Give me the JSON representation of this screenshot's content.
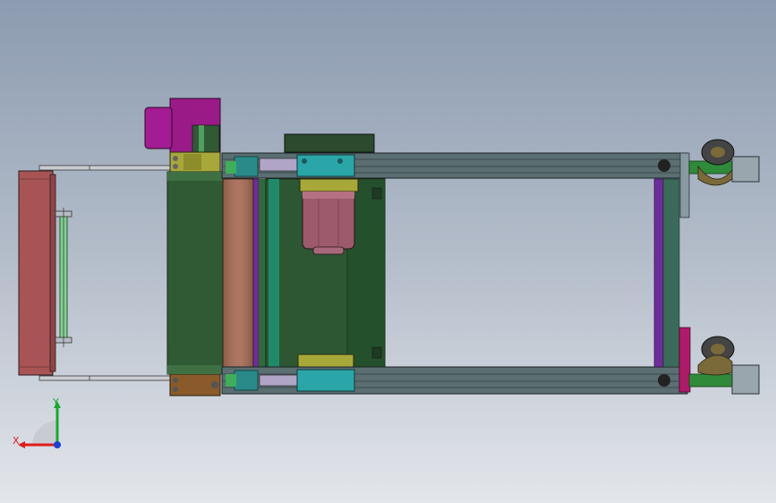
{
  "viewport": {
    "background_top": "#8c9bb0",
    "background_bottom": "#e3e6eb"
  },
  "triad": {
    "x_label": "X",
    "y_label": "Y",
    "x_color": "#e01b1b",
    "y_color": "#19a832",
    "z_color": "#1a3fd6"
  },
  "colors": {
    "frame_rail": "#5b6f72",
    "roller_green": "#2f5a34",
    "roller_copper": "#a66b55",
    "motor_pink": "#9c5a6c",
    "gearbox_magenta": "#9a1a88",
    "guard_red": "#a85455",
    "guide_purple": "#6e2d9a",
    "mount_yellow": "#a8a83a",
    "cyan_part": "#2aa6a8",
    "wheel_olive": "#7a6a3a"
  }
}
